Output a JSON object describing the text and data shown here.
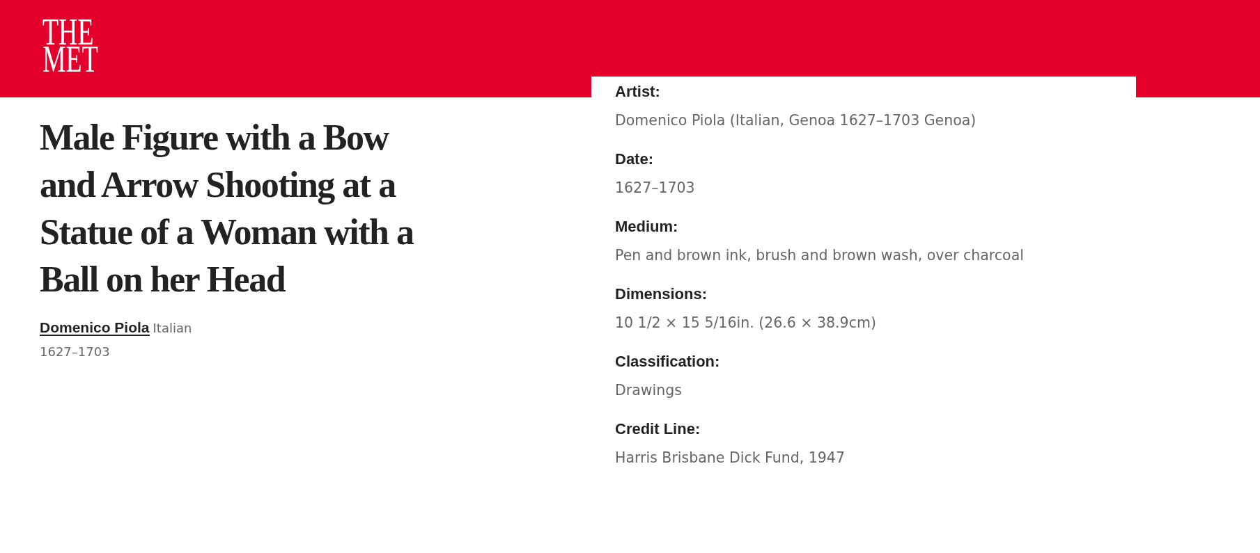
{
  "header": {
    "logo": {
      "lines": [
        "THE",
        "MET"
      ]
    }
  },
  "artwork": {
    "title": "Male Figure with a Bow and Arrow Shooting at a Statue of a Woman with a Ball on her Head",
    "artist": "Domenico Piola",
    "nationality": "Italian",
    "date": "1627–1703"
  },
  "details": [
    {
      "label": "Artist:",
      "value": "Domenico Piola (Italian, Genoa 1627–1703 Genoa)"
    },
    {
      "label": "Date:",
      "value": "1627–1703"
    },
    {
      "label": "Medium:",
      "value": "Pen and brown ink, brush and brown wash, over charcoal"
    },
    {
      "label": "Dimensions:",
      "value": "10 1/2 × 15 5/16in. (26.6 × 38.9cm)"
    },
    {
      "label": "Classification:",
      "value": "Drawings"
    },
    {
      "label": "Credit Line:",
      "value": "Harris Brisbane Dick Fund, 1947"
    }
  ]
}
